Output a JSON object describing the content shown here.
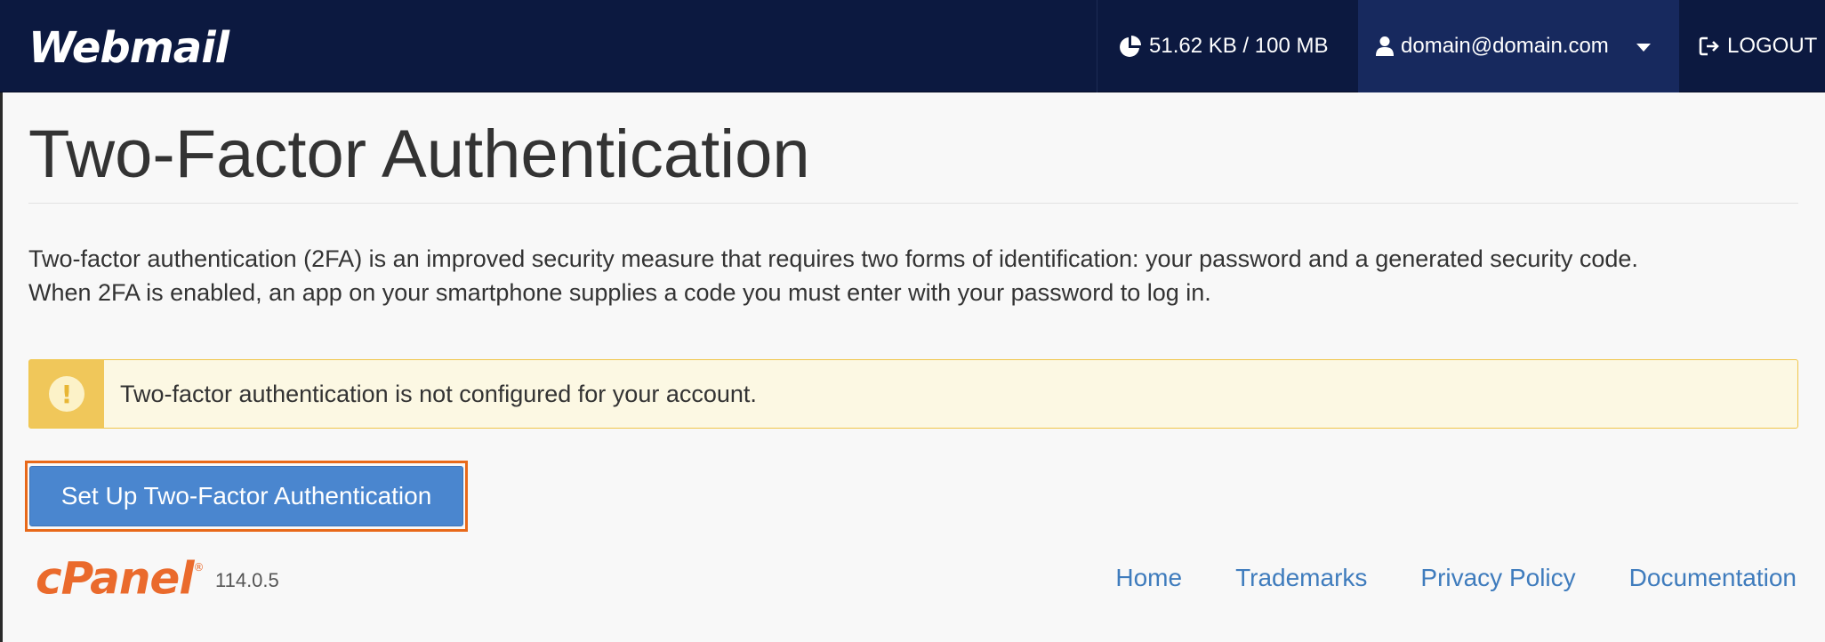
{
  "header": {
    "brand": "Webmail",
    "quota": "51.62 KB / 100 MB",
    "quota_icon": "pie-chart-icon",
    "user": "domain@domain.com",
    "user_icon": "user-icon",
    "logout": "LOGOUT",
    "logout_icon": "sign-out-icon",
    "colors": {
      "background": "#0c1940",
      "user_background": "#17295e"
    }
  },
  "main": {
    "title": "Two-Factor Authentication",
    "description_line1": "Two-factor authentication (2FA) is an improved security measure that requires two forms of identification: your password and a generated security code.",
    "description_line2": "When 2FA is enabled, an app on your smartphone supplies a code you must enter with your password to log in.",
    "alert": {
      "icon": "exclamation-icon",
      "text": "Two-factor authentication is not configured for your account.",
      "colors": {
        "side": "#f0c75a",
        "background": "#fcf8e3"
      }
    },
    "setup_button": "Set Up Two-Factor Authentication"
  },
  "footer": {
    "logo": "cPanel",
    "logo_mark": "®",
    "version": "114.0.5",
    "links": [
      "Home",
      "Trademarks",
      "Privacy Policy",
      "Documentation"
    ],
    "colors": {
      "logo": "#ea6a2c",
      "link": "#3f7cbd"
    }
  }
}
